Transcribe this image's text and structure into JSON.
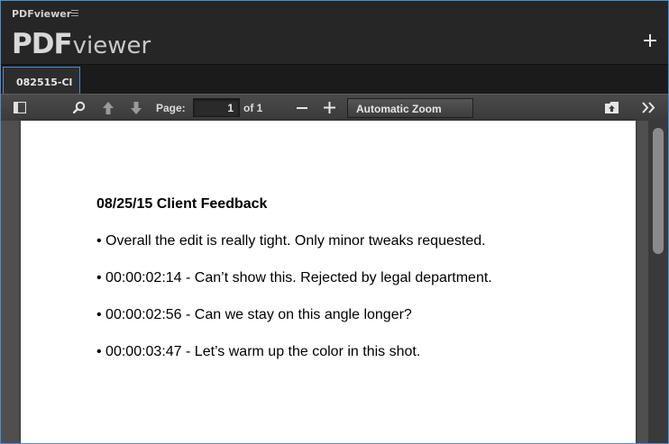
{
  "panel": {
    "title": "PDFviewer"
  },
  "brand": {
    "pdf": "PDF",
    "viewer": "viewer"
  },
  "tabs": [
    {
      "label": "082515-Cl"
    }
  ],
  "toolbar": {
    "page_label": "Page:",
    "page_value": "1",
    "of_label": "of 1",
    "zoom_label": "Automatic Zoom"
  },
  "document": {
    "title": "08/25/15 Client Feedback",
    "lines": [
      "• Overall the edit is really tight. Only minor tweaks requested.",
      "• 00:00:02:14 - Can’t show this. Rejected by legal department.",
      "• 00:00:02:56 - Can we stay on this angle longer?",
      "• 00:00:03:47 - Let’s warm up the color in this shot."
    ]
  },
  "colors": {
    "accent": "#4a8fd1",
    "toolbar": "#404040",
    "background": "#232323"
  },
  "icons": [
    "menu-icon",
    "add-icon",
    "sidebar-toggle-icon",
    "search-icon",
    "previous-page-icon",
    "next-page-icon",
    "zoom-out-icon",
    "zoom-in-icon",
    "open-file-icon",
    "tools-icon"
  ]
}
